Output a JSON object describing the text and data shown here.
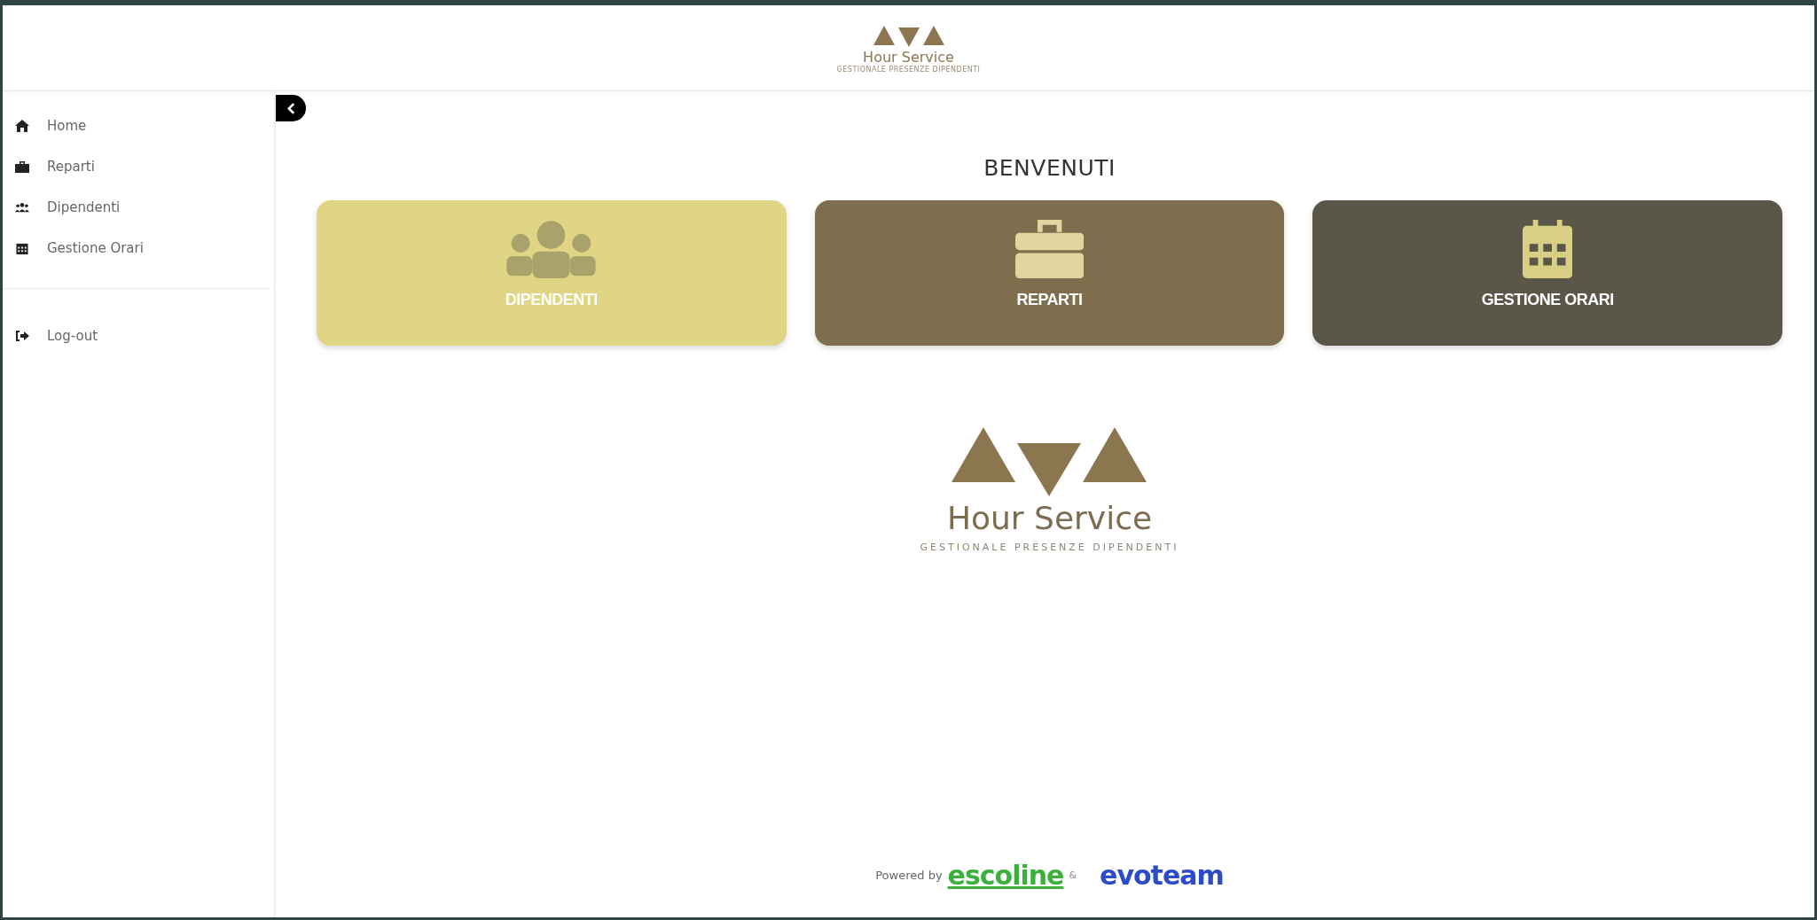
{
  "header": {
    "logo_title": "Hour Service",
    "logo_subtitle": "GESTIONALE PRESENZE DIPENDENTI"
  },
  "sidebar": {
    "items": [
      {
        "kind": "home",
        "label": "Home"
      },
      {
        "kind": "briefcase",
        "label": "Reparti"
      },
      {
        "kind": "users",
        "label": "Dipendenti"
      },
      {
        "kind": "calendar",
        "label": "Gestione Orari"
      }
    ],
    "footer_items": [
      {
        "kind": "logout",
        "label": "Log-out"
      }
    ]
  },
  "main": {
    "heading": "BENVENUTI",
    "cards": [
      {
        "kind": "users",
        "label": "DIPENDENTI",
        "color": "#e0d585"
      },
      {
        "kind": "briefcase",
        "label": "REPARTI",
        "color": "#7f6e4e"
      },
      {
        "kind": "calendar",
        "label": "GESTIONE ORARI",
        "color": "#5a5749"
      }
    ],
    "logo_title": "Hour Service",
    "logo_subtitle": "GESTIONALE PRESENZE DIPENDENTI"
  },
  "footer": {
    "powered_by": "Powered by",
    "brand_1": "escoline",
    "separator": "&",
    "brand_2": "evoteam"
  }
}
